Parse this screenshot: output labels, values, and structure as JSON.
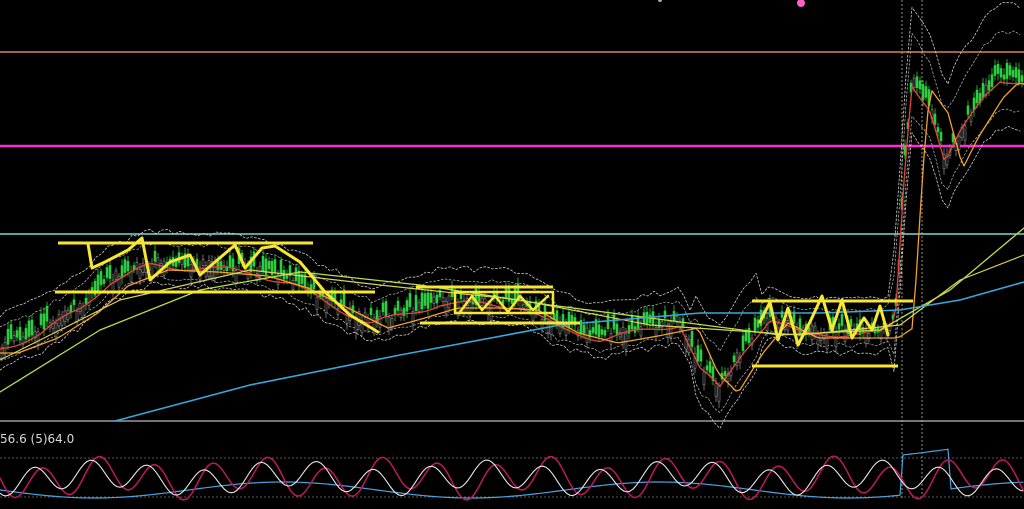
{
  "chart_data": {
    "type": "line",
    "oscillator_label": "56.6 (5)64.0",
    "colors": {
      "background": "#000000",
      "orange_hline": "#d9844a",
      "magenta_hline": "#ff2bd6",
      "cyan_hline": "#7ed6df",
      "yellow_markup": "#f7e633",
      "candles_green": "#2ecc40",
      "ma_red": "#e2473c",
      "ma_orange": "#f0a030",
      "ma_lightgreen": "#b8e04a",
      "ma_blue": "#3aa7d8",
      "osc_magenta": "#c2185b",
      "osc_white": "#e6e6e6",
      "osc_blue": "#4aa3df",
      "gray_separator": "#9a9a9a"
    }
  }
}
